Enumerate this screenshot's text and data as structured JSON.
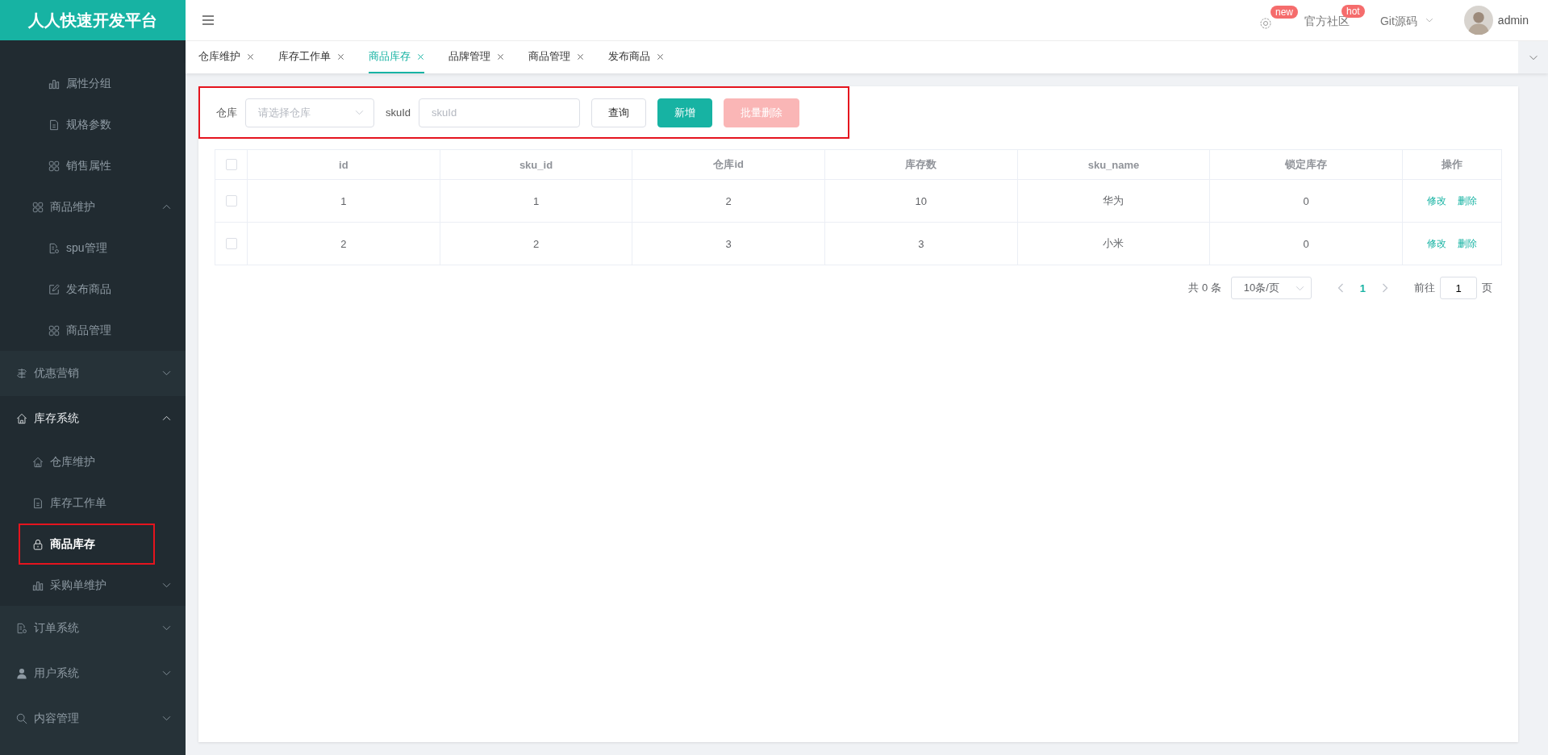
{
  "header": {
    "logo": "人人快速开发平台",
    "settings_badge": "new",
    "nav": [
      {
        "label": "官方社区",
        "badge": "hot",
        "dropdown": false
      },
      {
        "label": "Git源码",
        "dropdown": true
      }
    ],
    "user": "admin"
  },
  "sidebar": {
    "partial_group": [
      {
        "children": [
          {
            "label": "属性分组",
            "selected": false
          },
          {
            "label": "规格参数",
            "selected": false
          },
          {
            "label": "销售属性",
            "selected": false
          }
        ]
      },
      {
        "label": "商品维护",
        "expanded": true,
        "children": [
          {
            "label": "spu管理",
            "selected": false
          },
          {
            "label": "发布商品",
            "selected": false
          },
          {
            "label": "商品管理",
            "selected": false
          }
        ]
      }
    ],
    "items": [
      {
        "label": "优惠营销",
        "expanded": false
      },
      {
        "label": "库存系统",
        "expanded": true,
        "children": [
          {
            "label": "仓库维护",
            "selected": false,
            "highlighted": false
          },
          {
            "label": "库存工作单",
            "selected": false,
            "highlighted": false
          },
          {
            "label": "商品库存",
            "selected": true,
            "highlighted": true
          },
          {
            "label": "采购单维护",
            "selected": false,
            "highlighted": false,
            "expanded": false
          }
        ]
      },
      {
        "label": "订单系统",
        "expanded": false
      },
      {
        "label": "用户系统",
        "expanded": false
      },
      {
        "label": "内容管理",
        "expanded": false
      }
    ]
  },
  "tabs": [
    {
      "label": "仓库维护",
      "selected": false
    },
    {
      "label": "库存工作单",
      "selected": false
    },
    {
      "label": "商品库存",
      "selected": true
    },
    {
      "label": "品牌管理",
      "selected": false
    },
    {
      "label": "商品管理",
      "selected": false
    },
    {
      "label": "发布商品",
      "selected": false
    }
  ],
  "filter": {
    "highlighted": true,
    "warehouse_label": "仓库",
    "warehouse_placeholder": "请选择仓库",
    "sku_label": "skuId",
    "sku_placeholder": "skuId",
    "buttons": [
      {
        "label": "查询",
        "kind": "default",
        "disabled": false
      },
      {
        "label": "新增",
        "kind": "primary",
        "disabled": false
      },
      {
        "label": "批量删除",
        "kind": "danger",
        "disabled": true
      }
    ]
  },
  "table": {
    "select_all_checked": false,
    "columns": [
      "id",
      "sku_id",
      "仓库id",
      "库存数",
      "sku_name",
      "锁定库存",
      "操作"
    ],
    "rows": [
      {
        "checked": false,
        "cells": [
          "1",
          "1",
          "2",
          "10",
          "华为",
          "0"
        ],
        "actions": [
          "修改",
          "删除"
        ]
      },
      {
        "checked": false,
        "cells": [
          "2",
          "2",
          "3",
          "3",
          "小米",
          "0"
        ],
        "actions": [
          "修改",
          "删除"
        ]
      }
    ]
  },
  "pagination": {
    "total": "共 0 条",
    "page_size": "10条/页",
    "pages": [
      {
        "label": "1",
        "selected": true
      }
    ],
    "goto_label": "前往",
    "goto_value": "1",
    "goto_suffix": "页"
  }
}
